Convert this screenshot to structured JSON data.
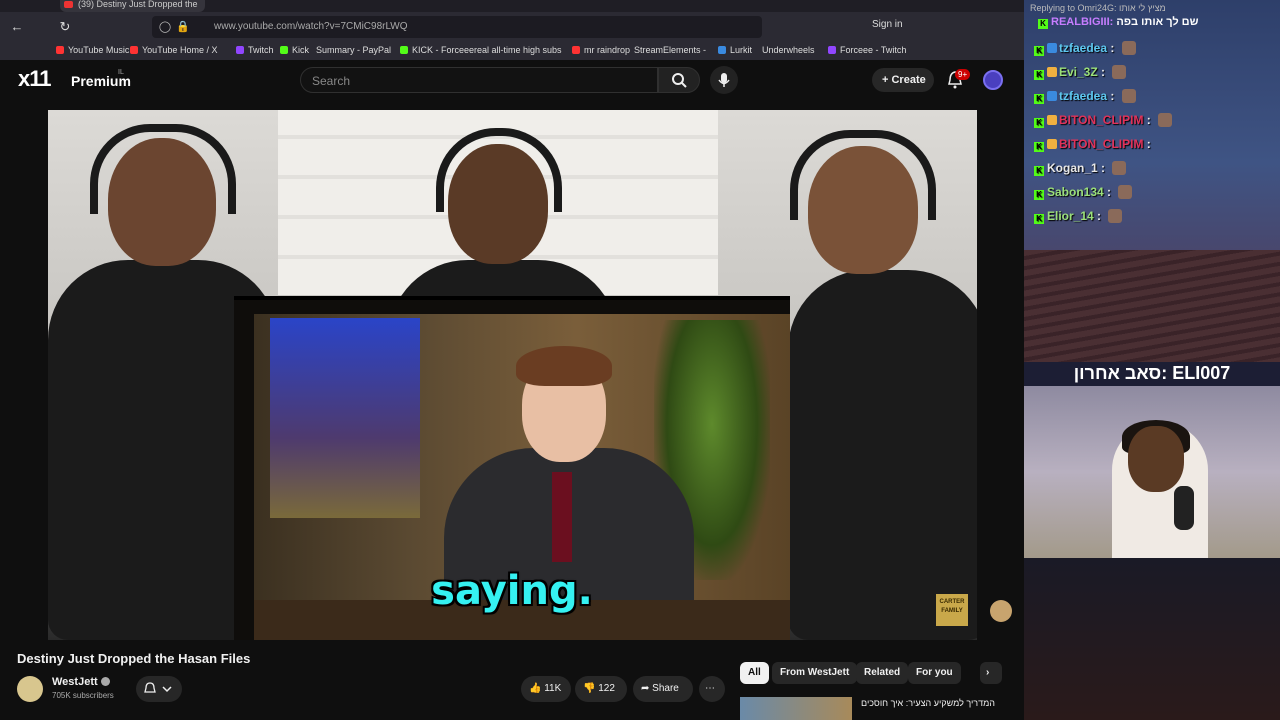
{
  "browser": {
    "tab_title": "(39) Destiny Just Dropped the",
    "url": "www.youtube.com/watch?v=7CMiC98rLWQ",
    "signin_label": "Sign in",
    "bookmarks": [
      "YouTube Music",
      "YouTube",
      "Home / X",
      "Twitch",
      "Kick",
      "Summary - PayPal",
      "KICK - Forceee",
      "real all-time high subs",
      "mr raindrop",
      "StreamElements -",
      "Lurkit",
      "Underwheels",
      "Forceee - Twitch"
    ]
  },
  "youtube": {
    "logo_text": "x11",
    "logo_premium": "Premium",
    "logo_region": "IL",
    "search_placeholder": "Search",
    "create_label": "Create",
    "notification_count": "9+"
  },
  "video": {
    "caption": "saying.",
    "watermark": "CARTER FAMILY",
    "title": "Destiny Just Dropped the Hasan Files",
    "channel_name": "WestJett",
    "channel_subscribers": "705K subscribers",
    "likes": "11K",
    "dislikes": "122",
    "share_label": "Share"
  },
  "recommendations": {
    "chips": [
      "All",
      "From WestJett",
      "Related",
      "For you"
    ],
    "first_title": "המדריך למשקיע הצעיר: איך חוסכים"
  },
  "chat": {
    "reply_line": "Replying to Omri24G: מציץ לי אותו",
    "pinned_user": "REALBIGIII:",
    "pinned_text": "שם לך אותו בפה",
    "messages": [
      {
        "user": "tzfaedea",
        "color": "#5ec8f0"
      },
      {
        "user": "Evi_3Z",
        "color": "#9be07a"
      },
      {
        "user": "tzfaedea",
        "color": "#5ec8f0"
      },
      {
        "user": "BITON_CLIPIM",
        "color": "#e0325a"
      },
      {
        "user": "BITON_CLIPIM",
        "color": "#e0325a"
      },
      {
        "user": "Kogan_1",
        "color": "#e8e8e8"
      },
      {
        "user": "Sabon134",
        "color": "#9be07a"
      },
      {
        "user": "Elior_14",
        "color": "#9be07a"
      }
    ],
    "cam_label": "סאב אחרון: ELI007"
  },
  "icons": [
    "back-icon",
    "reload-icon",
    "shield-icon",
    "lock-icon",
    "search-icon",
    "mic-icon",
    "plus-icon",
    "bell-icon",
    "like-icon",
    "dislike-icon",
    "share-icon",
    "more-icon",
    "chevron-right-icon",
    "kick-icon"
  ]
}
